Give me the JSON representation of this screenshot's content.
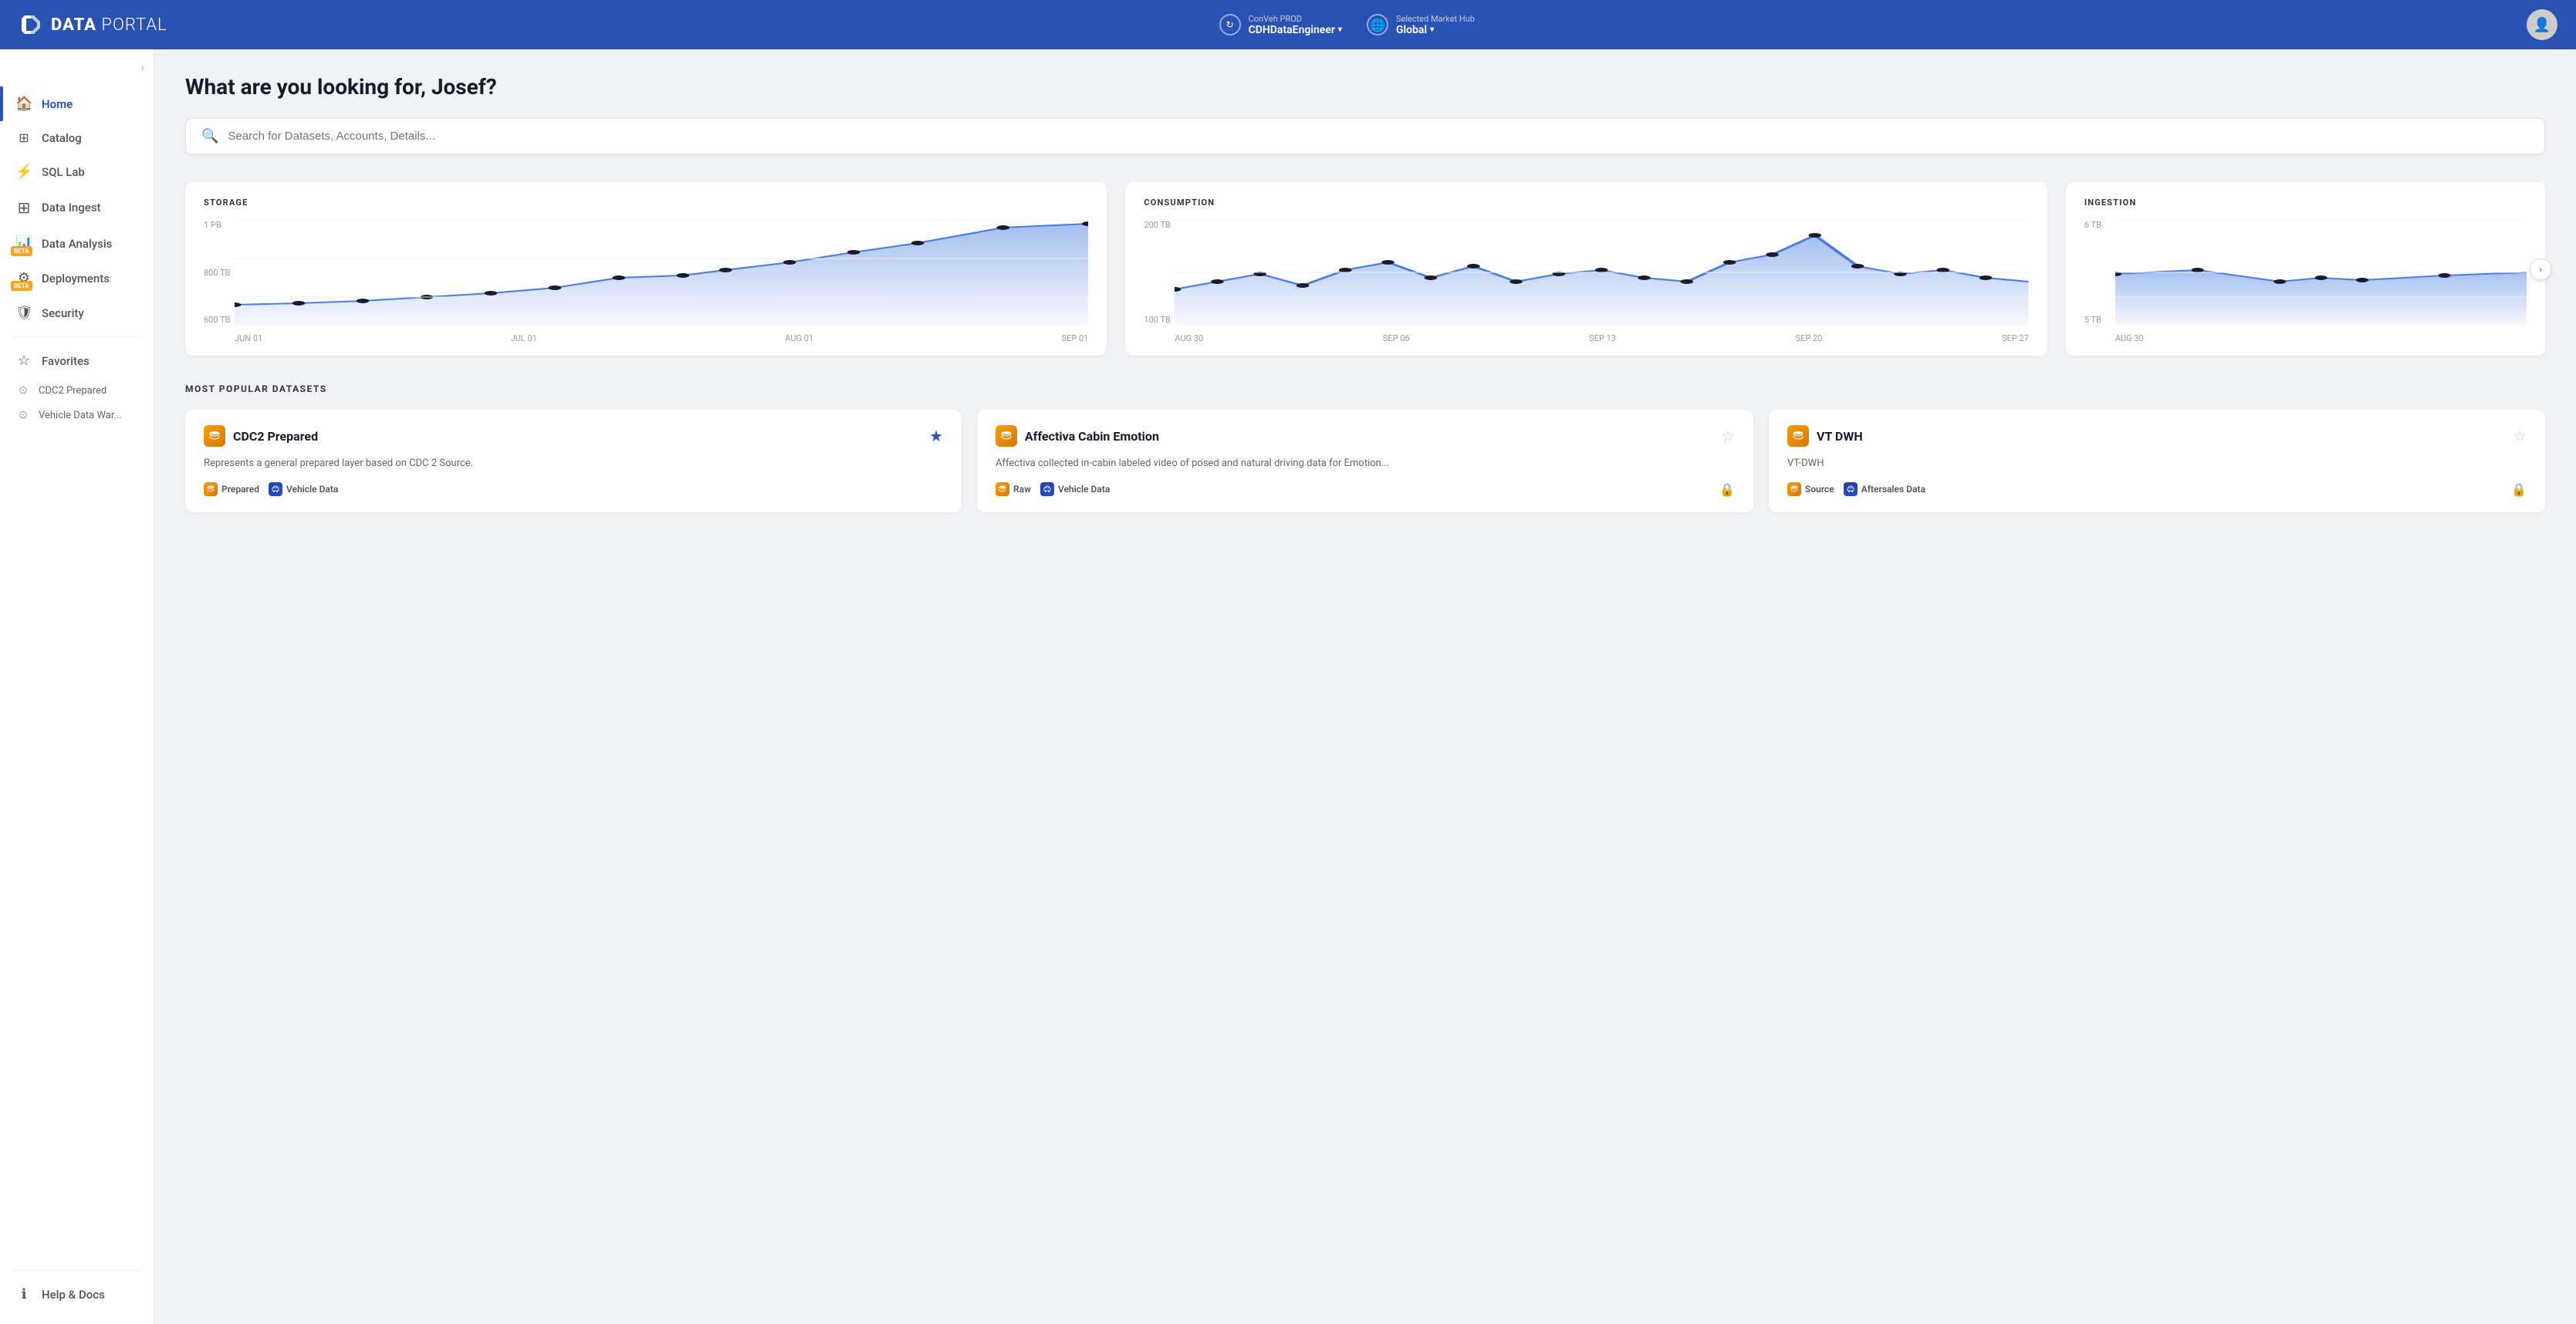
{
  "header": {
    "logo_bold": "DATA",
    "logo_light": " PORTAL",
    "conveh": {
      "label": "ConVeh PROD",
      "value": "CDHDataEngineer"
    },
    "market": {
      "label": "Selected Market Hub",
      "value": "Global"
    }
  },
  "sidebar": {
    "collapse_icon": "‹",
    "items": [
      {
        "id": "home",
        "label": "Home",
        "icon": "🏠",
        "active": true
      },
      {
        "id": "catalog",
        "label": "Catalog",
        "icon": "⊞",
        "active": false
      },
      {
        "id": "sql-lab",
        "label": "SQL Lab",
        "icon": "⚡",
        "active": false
      },
      {
        "id": "data-ingest",
        "label": "Data Ingest",
        "icon": "→",
        "active": false,
        "beta": false
      },
      {
        "id": "data-analysis",
        "label": "Data Analysis",
        "icon": "📊",
        "active": false,
        "beta": true
      },
      {
        "id": "deployments",
        "label": "Deployments",
        "icon": "⚙",
        "active": false,
        "beta": true
      },
      {
        "id": "security",
        "label": "Security",
        "icon": "🛡",
        "active": false
      }
    ],
    "starred_items": [
      {
        "id": "cdc2-prepared",
        "label": "CDC2 Prepared"
      },
      {
        "id": "vehicle-data-war",
        "label": "Vehicle Data War..."
      }
    ],
    "favorites_label": "Favorites",
    "bottom_items": [
      {
        "id": "help-docs",
        "label": "Help & Docs",
        "icon": "ℹ"
      }
    ]
  },
  "main": {
    "greeting": "What are you looking for, Josef?",
    "search_placeholder": "Search for Datasets, Accounts, Details...",
    "storage_chart": {
      "title": "STORAGE",
      "y_labels": [
        "1 PB",
        "800 TB",
        "600 TB"
      ],
      "x_labels": [
        "JUN 01",
        "JUL 01",
        "AUG 01",
        "SEP 01"
      ],
      "color": "#4a7fe0"
    },
    "consumption_chart": {
      "title": "CONSUMPTION",
      "y_labels": [
        "200 TB",
        "100 TB"
      ],
      "x_labels": [
        "AUG 30",
        "SEP 06",
        "SEP 13",
        "SEP 20",
        "SEP 27"
      ],
      "color": "#4a7fe0"
    },
    "ingestion_chart": {
      "title": "INGESTION",
      "y_labels": [
        "6 TB",
        "5 TB"
      ],
      "x_labels": [
        "AUG 30"
      ],
      "color": "#4a7fe0",
      "has_next": true
    },
    "datasets_section_title": "MOST POPULAR DATASETS",
    "datasets": [
      {
        "id": "cdc2-prepared",
        "title": "CDC2 Prepared",
        "description": "Represents a general prepared layer based on CDC 2 Source.",
        "starred": true,
        "tags": [
          {
            "label": "Prepared",
            "type": "orange"
          },
          {
            "label": "Vehicle Data",
            "type": "blue-dark"
          }
        ],
        "locked": false
      },
      {
        "id": "affectiva-cabin",
        "title": "Affectiva Cabin Emotion",
        "description": "Affectiva collected in-cabin labeled video of posed and natural driving data for Emotion...",
        "starred": false,
        "tags": [
          {
            "label": "Raw",
            "type": "orange"
          },
          {
            "label": "Vehicle Data",
            "type": "blue-dark"
          }
        ],
        "locked": true
      },
      {
        "id": "vt-dwh",
        "title": "VT DWH",
        "description": "VT-DWH",
        "starred": false,
        "tags": [
          {
            "label": "Source",
            "type": "orange"
          },
          {
            "label": "Aftersales Data",
            "type": "blue-dark"
          }
        ],
        "locked": true
      }
    ]
  }
}
